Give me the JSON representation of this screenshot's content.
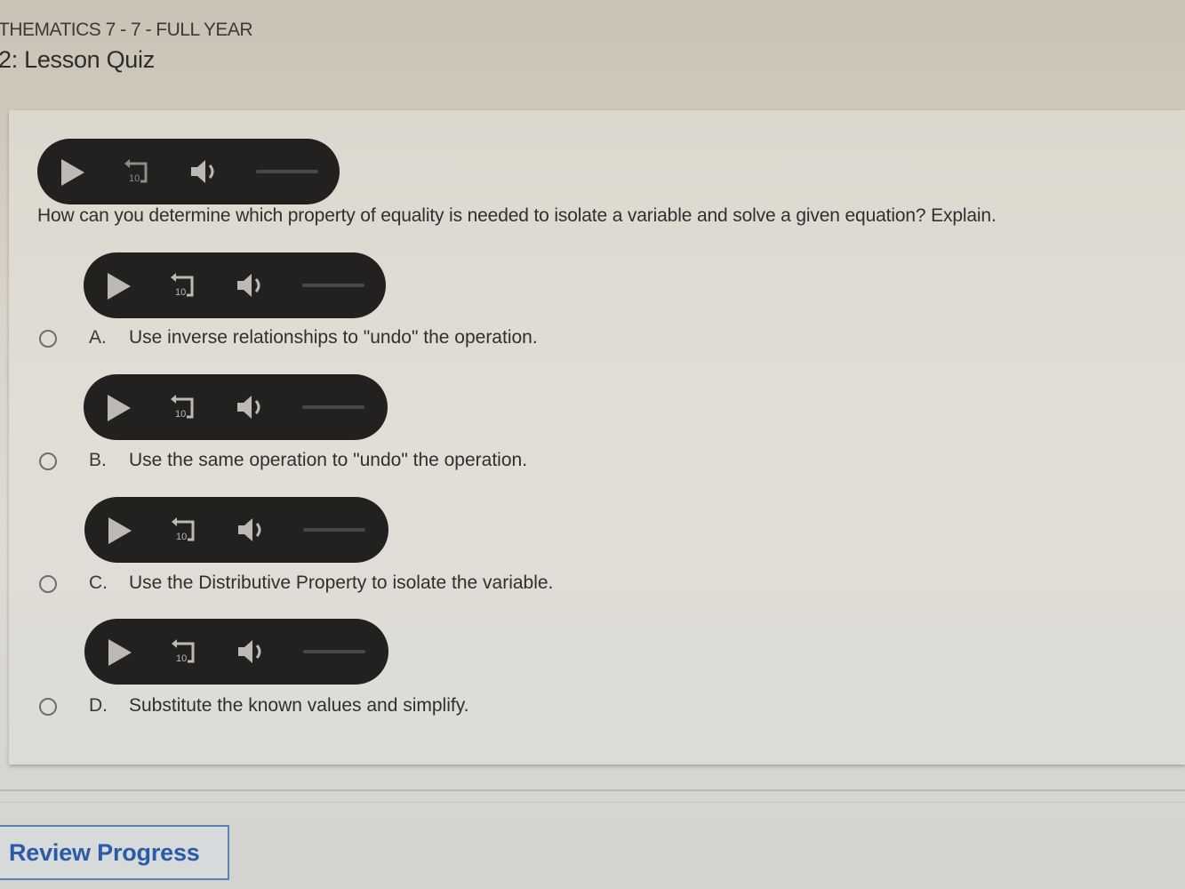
{
  "header": {
    "course": "THEMATICS 7 - 7 - FULL YEAR",
    "quiz_title": "2: Lesson Quiz"
  },
  "question": {
    "text": "How can you determine which property of equality is needed to isolate a variable and solve a given equation? Explain."
  },
  "audio_player": {
    "replay_label": "10",
    "icons": [
      "play-icon",
      "replay-10-icon",
      "volume-icon"
    ]
  },
  "options": [
    {
      "letter": "A.",
      "text": "Use inverse relationships to \"undo\" the operation."
    },
    {
      "letter": "B.",
      "text": "Use the same operation to \"undo\" the operation."
    },
    {
      "letter": "C.",
      "text": "Use the Distributive Property to isolate the variable."
    },
    {
      "letter": "D.",
      "text": "Substitute the known values and simplify."
    }
  ],
  "footer": {
    "review_button": "Review Progress"
  },
  "colors": {
    "player_bg": "#232020",
    "accent_blue": "#2a5aa8"
  }
}
